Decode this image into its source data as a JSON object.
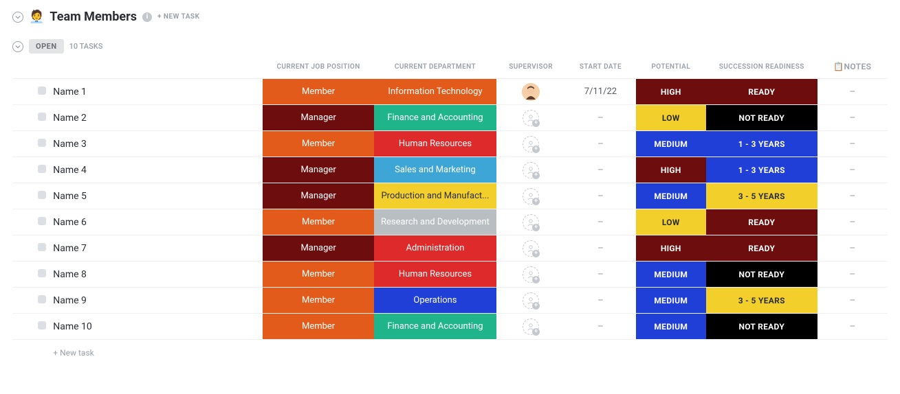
{
  "header": {
    "emoji": "🧑‍💼",
    "title": "Team Members",
    "new_task_label": "+ NEW TASK"
  },
  "group": {
    "status_label": "OPEN",
    "count_label": "10 TASKS"
  },
  "columns": {
    "position": "CURRENT JOB POSITION",
    "department": "CURRENT DEPARTMENT",
    "supervisor": "SUPERVISOR",
    "start_date": "START DATE",
    "potential": "POTENTIAL",
    "succession": "SUCCESSION READINESS",
    "notes": "📋NOTES"
  },
  "new_task_row": "+ New task",
  "colors": {
    "orange": "#e35b1a",
    "darkRed": "#6d0d0d",
    "red": "#de2a2a",
    "teal": "#1fb48a",
    "skyBlue": "#3da6d6",
    "blue": "#1f3fd6",
    "yellow": "#f2cf2a",
    "silver": "#b9bec3",
    "black": "#000000",
    "yellowText": "#2a2e34"
  },
  "rows": [
    {
      "name": "Name 1",
      "position": {
        "label": "Member",
        "bg": "orange"
      },
      "department": {
        "label": "Information Technology",
        "bg": "orange"
      },
      "supervisor": "avatar",
      "start_date": "7/11/22",
      "potential": {
        "label": "HIGH",
        "bg": "darkRed",
        "fg": "#fff"
      },
      "succession": {
        "label": "READY",
        "bg": "darkRed",
        "fg": "#fff"
      },
      "notes": "–"
    },
    {
      "name": "Name 2",
      "position": {
        "label": "Manager",
        "bg": "darkRed"
      },
      "department": {
        "label": "Finance and Accounting",
        "bg": "teal"
      },
      "supervisor": "empty",
      "start_date": "–",
      "potential": {
        "label": "LOW",
        "bg": "yellow",
        "fg": "yellowText"
      },
      "succession": {
        "label": "NOT READY",
        "bg": "black",
        "fg": "#fff"
      },
      "notes": "–"
    },
    {
      "name": "Name 3",
      "position": {
        "label": "Member",
        "bg": "orange"
      },
      "department": {
        "label": "Human Resources",
        "bg": "red"
      },
      "supervisor": "empty",
      "start_date": "–",
      "potential": {
        "label": "MEDIUM",
        "bg": "blue",
        "fg": "#fff"
      },
      "succession": {
        "label": "1 - 3 YEARS",
        "bg": "blue",
        "fg": "#fff"
      },
      "notes": "–"
    },
    {
      "name": "Name 4",
      "position": {
        "label": "Manager",
        "bg": "darkRed"
      },
      "department": {
        "label": "Sales and Marketing",
        "bg": "skyBlue"
      },
      "supervisor": "empty",
      "start_date": "–",
      "potential": {
        "label": "HIGH",
        "bg": "darkRed",
        "fg": "#fff"
      },
      "succession": {
        "label": "1 - 3 YEARS",
        "bg": "blue",
        "fg": "#fff"
      },
      "notes": "–"
    },
    {
      "name": "Name 5",
      "position": {
        "label": "Manager",
        "bg": "darkRed"
      },
      "department": {
        "label": "Production and Manufact...",
        "bg": "yellow",
        "fg": "yellowText"
      },
      "supervisor": "empty",
      "start_date": "–",
      "potential": {
        "label": "MEDIUM",
        "bg": "blue",
        "fg": "#fff"
      },
      "succession": {
        "label": "3 - 5 YEARS",
        "bg": "yellow",
        "fg": "yellowText"
      },
      "notes": "–"
    },
    {
      "name": "Name 6",
      "position": {
        "label": "Member",
        "bg": "orange"
      },
      "department": {
        "label": "Research and Development",
        "bg": "silver"
      },
      "supervisor": "empty",
      "start_date": "–",
      "potential": {
        "label": "LOW",
        "bg": "yellow",
        "fg": "yellowText"
      },
      "succession": {
        "label": "READY",
        "bg": "darkRed",
        "fg": "#fff"
      },
      "notes": "–"
    },
    {
      "name": "Name 7",
      "position": {
        "label": "Manager",
        "bg": "darkRed"
      },
      "department": {
        "label": "Administration",
        "bg": "red"
      },
      "supervisor": "empty",
      "start_date": "–",
      "potential": {
        "label": "HIGH",
        "bg": "darkRed",
        "fg": "#fff"
      },
      "succession": {
        "label": "READY",
        "bg": "darkRed",
        "fg": "#fff"
      },
      "notes": "–"
    },
    {
      "name": "Name 8",
      "position": {
        "label": "Member",
        "bg": "orange"
      },
      "department": {
        "label": "Human Resources",
        "bg": "red"
      },
      "supervisor": "empty",
      "start_date": "–",
      "potential": {
        "label": "MEDIUM",
        "bg": "blue",
        "fg": "#fff"
      },
      "succession": {
        "label": "NOT READY",
        "bg": "black",
        "fg": "#fff"
      },
      "notes": "–"
    },
    {
      "name": "Name 9",
      "position": {
        "label": "Member",
        "bg": "orange"
      },
      "department": {
        "label": "Operations",
        "bg": "blue"
      },
      "supervisor": "empty",
      "start_date": "–",
      "potential": {
        "label": "MEDIUM",
        "bg": "blue",
        "fg": "#fff"
      },
      "succession": {
        "label": "3 - 5 YEARS",
        "bg": "yellow",
        "fg": "yellowText"
      },
      "notes": "–"
    },
    {
      "name": "Name 10",
      "position": {
        "label": "Member",
        "bg": "orange"
      },
      "department": {
        "label": "Finance and Accounting",
        "bg": "teal"
      },
      "supervisor": "empty",
      "start_date": "–",
      "potential": {
        "label": "MEDIUM",
        "bg": "blue",
        "fg": "#fff"
      },
      "succession": {
        "label": "NOT READY",
        "bg": "black",
        "fg": "#fff"
      },
      "notes": "–"
    }
  ]
}
